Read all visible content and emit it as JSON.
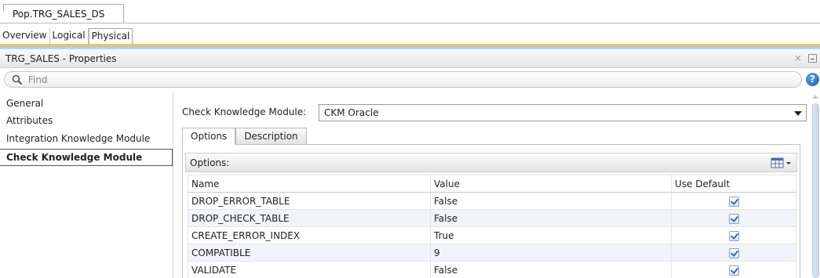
{
  "document_tab": {
    "label": "Pop.TRG_SALES_DS"
  },
  "view_tabs": [
    {
      "label": "Overview",
      "active": false
    },
    {
      "label": "Logical",
      "active": false
    },
    {
      "label": "Physical",
      "active": true
    }
  ],
  "properties_panel": {
    "title": "TRG_SALES - Properties",
    "close_glyph": "×"
  },
  "find": {
    "placeholder": "Find"
  },
  "help": {
    "glyph": "?"
  },
  "nav": {
    "items": [
      {
        "label": "General",
        "selected": false
      },
      {
        "label": "Attributes",
        "selected": false
      },
      {
        "label": "Integration Knowledge Module",
        "selected": false
      },
      {
        "label": "Check Knowledge Module",
        "selected": true
      }
    ]
  },
  "ckm": {
    "label": "Check Knowledge Module:",
    "selected": "CKM Oracle"
  },
  "subtabs": [
    {
      "label": "Options",
      "active": true
    },
    {
      "label": "Description",
      "active": false
    }
  ],
  "options": {
    "header": "Options:",
    "columns": [
      "Name",
      "Value",
      "Use Default"
    ],
    "rows": [
      {
        "name": "DROP_ERROR_TABLE",
        "value": "False",
        "use_default": true
      },
      {
        "name": "DROP_CHECK_TABLE",
        "value": "False",
        "use_default": true
      },
      {
        "name": "CREATE_ERROR_INDEX",
        "value": "True",
        "use_default": true
      },
      {
        "name": "COMPATIBLE",
        "value": "9",
        "use_default": true
      },
      {
        "name": "VALIDATE",
        "value": "False",
        "use_default": true
      }
    ]
  },
  "colors": {
    "accent_gold": "#f6c44e",
    "accent_blue": "#a9c4e2",
    "checkbox_tick": "#3a6bb5"
  },
  "icons": {
    "find": "search-icon",
    "help": "help-icon",
    "grid_menu": "table-columns-icon"
  }
}
